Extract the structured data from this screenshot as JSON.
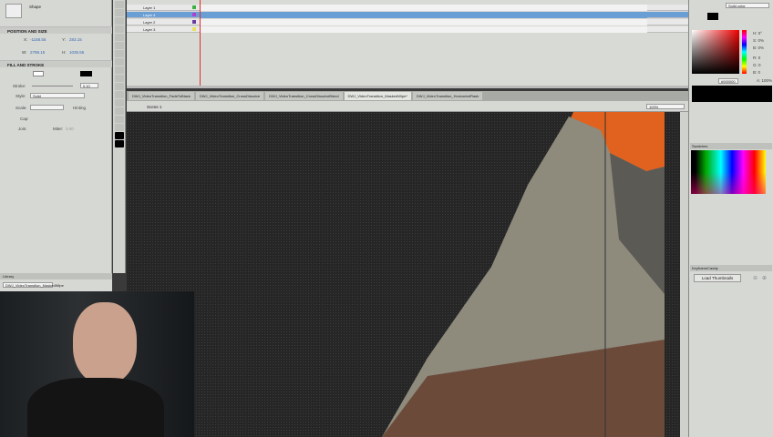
{
  "properties": {
    "type": "Shape",
    "position_section": "POSITION AND SIZE",
    "x_label": "X:",
    "x": "-1158.55",
    "y_label": "Y:",
    "y": "283.15",
    "w_label": "W:",
    "w": "2798.15",
    "h_label": "H:",
    "h": "1035.55",
    "fill_section": "FILL AND STROKE",
    "stroke_label": "Stroke:",
    "stroke": "0.10",
    "style_label": "Style:",
    "style": "Solid",
    "scale_label": "Scale:",
    "hinting": "Hinting",
    "cap_label": "Cap:",
    "join_label": "Join:",
    "miter_label": "Miter:",
    "miter": "3.00"
  },
  "library": {
    "title": "Library",
    "document": "DWJ_VideoTransition_MaskedWipe"
  },
  "timeline": {
    "layers": [
      {
        "name": "Layer 1",
        "color": "#3cb043"
      },
      {
        "name": "Layer 4",
        "color": "#b040d0",
        "selected": true
      },
      {
        "name": "Layer 2",
        "color": "#6a3aa0"
      },
      {
        "name": "Layer 3",
        "color": "#e8e060"
      }
    ]
  },
  "tabs": [
    {
      "label": "DWJ_VideoTransition_FadeToBlack"
    },
    {
      "label": "DWJ_VideoTransition_CrossDissolve"
    },
    {
      "label": "DWJ_VideoTransition_CrossDissolveBlend"
    },
    {
      "label": "DWJ_VideoTransition_MaskedWipe*",
      "active": true
    },
    {
      "label": "DWJ_VideoTransition_HorizontalFlash"
    }
  ],
  "scene": {
    "name": "Scene 1",
    "zoom": "100%"
  },
  "color_panel": {
    "type": "Solid color",
    "h": "H: 0°",
    "s": "S: 0%",
    "b": "B: 0%",
    "r": "R: 0",
    "g": "G: 0",
    "b2": "B: 0",
    "hex": "#000000",
    "alpha": "A: 100%"
  },
  "swatches": {
    "title": "Swatches"
  },
  "keyframe_caddy": {
    "title": "KeyframeCaddy",
    "button": "Load Thumbnails"
  }
}
